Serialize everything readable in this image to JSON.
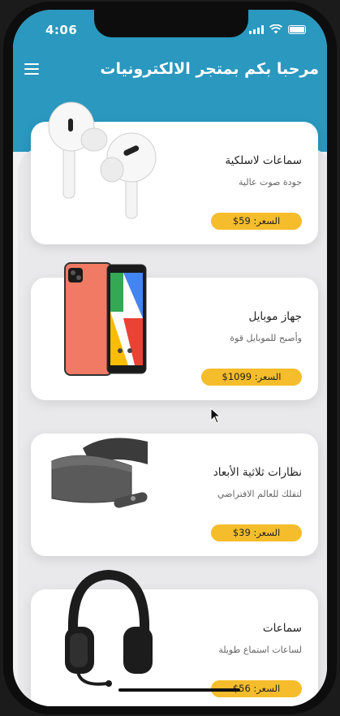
{
  "status_bar": {
    "time": "4:06"
  },
  "header": {
    "title": "مرحبا بكم بمتجر الالكترونيات"
  },
  "products": [
    {
      "name": "سماعات لاسلكية",
      "subtitle": "جودة صوت عالية",
      "price": "السعر: 59$",
      "icon": "airpods-image"
    },
    {
      "name": "جهاز موبايل",
      "subtitle": "وأصبح للموبايل قوة",
      "price": "السعر: 1099$",
      "icon": "phone-image"
    },
    {
      "name": "نظارات ثلاثية الأبعاد",
      "subtitle": "لتقلك للعالم الافتراضي",
      "price": "السعر: 39$",
      "icon": "vr-headset-image"
    },
    {
      "name": "سماعات",
      "subtitle": "لساعات استماع طويلة",
      "price": "السعر: 56$",
      "icon": "headphones-image"
    }
  ],
  "colors": {
    "header": "#2a98bf",
    "price_badge": "#f5bd2c",
    "background": "#e9e9eb"
  }
}
